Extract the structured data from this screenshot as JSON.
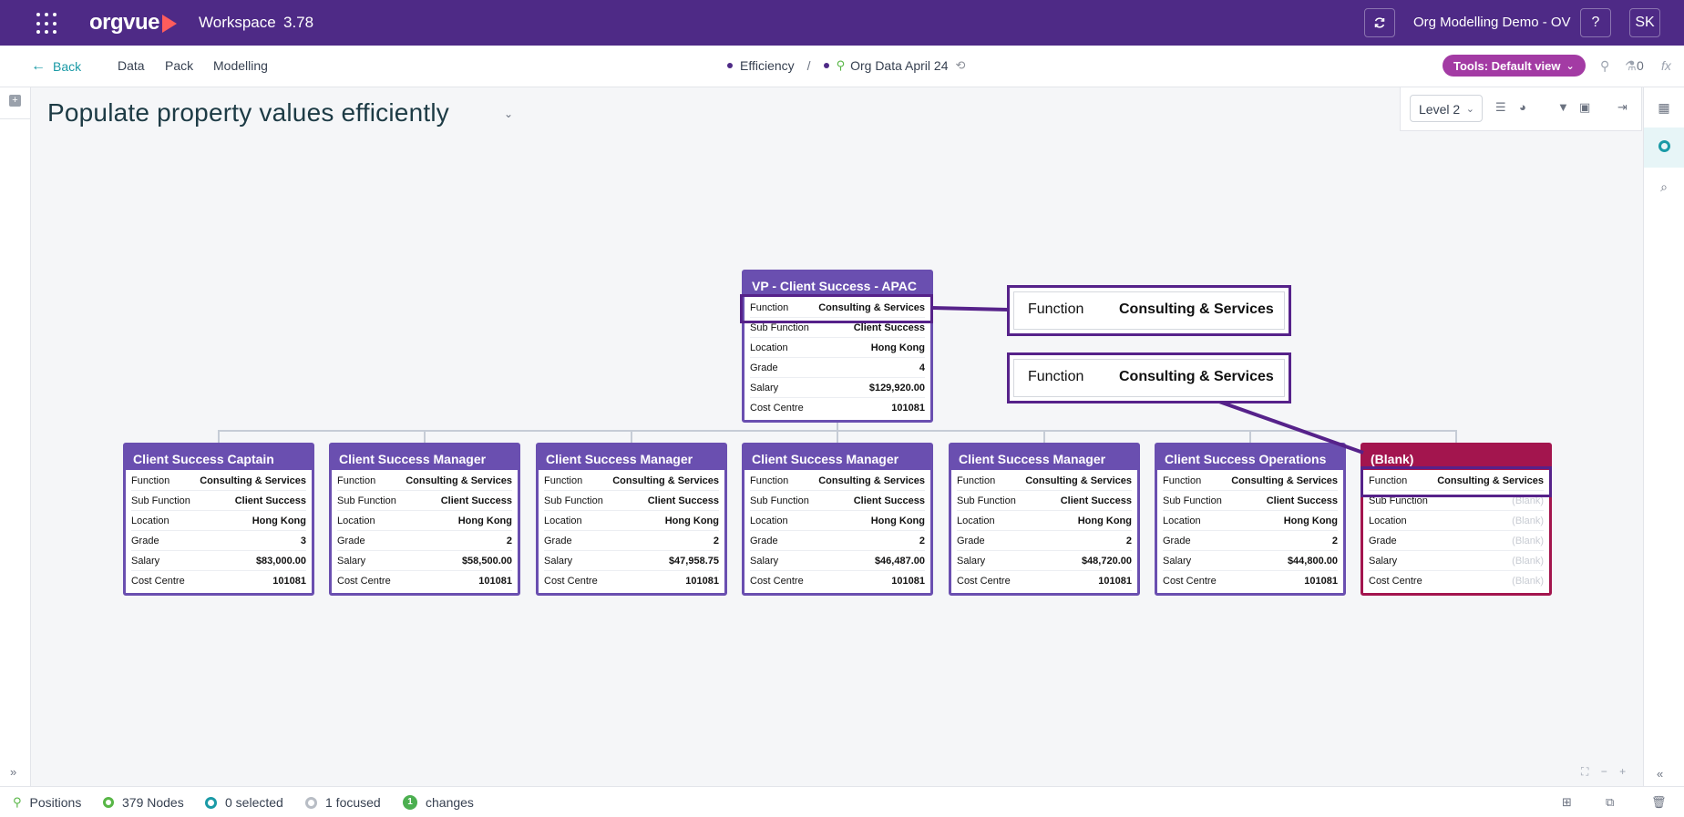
{
  "topbar": {
    "app_logo": "orgvue",
    "workspace_title": "Workspace",
    "workspace_version": "3.78",
    "project_name": "Org Modelling Demo - OV",
    "help_label": "?",
    "user_initials": "SK"
  },
  "nav": {
    "back": "Back",
    "items": [
      "Data",
      "Pack",
      "Modelling"
    ],
    "breadcrumb": {
      "view": "Efficiency",
      "separator": "/",
      "dataset": "Org Data April 24"
    },
    "tools_button": "Tools: Default view"
  },
  "status_counter": "0",
  "page": {
    "title": "Populate property values efficiently"
  },
  "view_toolbar": {
    "level": "Level 2"
  },
  "root_card": {
    "title": "VP - Client Success - APAC",
    "rows": [
      {
        "k": "Function",
        "v": "Consulting & Services"
      },
      {
        "k": "Sub Function",
        "v": "Client Success"
      },
      {
        "k": "Location",
        "v": "Hong Kong"
      },
      {
        "k": "Grade",
        "v": "4"
      },
      {
        "k": "Salary",
        "v": "$129,920.00"
      },
      {
        "k": "Cost Centre",
        "v": "101081"
      }
    ]
  },
  "child_cards": [
    {
      "title": "Client Success Captain",
      "rows": [
        {
          "k": "Function",
          "v": "Consulting & Services"
        },
        {
          "k": "Sub Function",
          "v": "Client Success"
        },
        {
          "k": "Location",
          "v": "Hong Kong"
        },
        {
          "k": "Grade",
          "v": "3"
        },
        {
          "k": "Salary",
          "v": "$83,000.00"
        },
        {
          "k": "Cost Centre",
          "v": "101081"
        }
      ]
    },
    {
      "title": "Client Success Manager",
      "rows": [
        {
          "k": "Function",
          "v": "Consulting & Services"
        },
        {
          "k": "Sub Function",
          "v": "Client Success"
        },
        {
          "k": "Location",
          "v": "Hong Kong"
        },
        {
          "k": "Grade",
          "v": "2"
        },
        {
          "k": "Salary",
          "v": "$58,500.00"
        },
        {
          "k": "Cost Centre",
          "v": "101081"
        }
      ]
    },
    {
      "title": "Client Success Manager",
      "rows": [
        {
          "k": "Function",
          "v": "Consulting & Services"
        },
        {
          "k": "Sub Function",
          "v": "Client Success"
        },
        {
          "k": "Location",
          "v": "Hong Kong"
        },
        {
          "k": "Grade",
          "v": "2"
        },
        {
          "k": "Salary",
          "v": "$47,958.75"
        },
        {
          "k": "Cost Centre",
          "v": "101081"
        }
      ]
    },
    {
      "title": "Client Success Manager",
      "rows": [
        {
          "k": "Function",
          "v": "Consulting & Services"
        },
        {
          "k": "Sub Function",
          "v": "Client Success"
        },
        {
          "k": "Location",
          "v": "Hong Kong"
        },
        {
          "k": "Grade",
          "v": "2"
        },
        {
          "k": "Salary",
          "v": "$46,487.00"
        },
        {
          "k": "Cost Centre",
          "v": "101081"
        }
      ]
    },
    {
      "title": "Client Success Manager",
      "rows": [
        {
          "k": "Function",
          "v": "Consulting & Services"
        },
        {
          "k": "Sub Function",
          "v": "Client Success"
        },
        {
          "k": "Location",
          "v": "Hong Kong"
        },
        {
          "k": "Grade",
          "v": "2"
        },
        {
          "k": "Salary",
          "v": "$48,720.00"
        },
        {
          "k": "Cost Centre",
          "v": "101081"
        }
      ]
    },
    {
      "title": "Client Success Operations",
      "rows": [
        {
          "k": "Function",
          "v": "Consulting & Services"
        },
        {
          "k": "Sub Function",
          "v": "Client Success"
        },
        {
          "k": "Location",
          "v": "Hong Kong"
        },
        {
          "k": "Grade",
          "v": "2"
        },
        {
          "k": "Salary",
          "v": "$44,800.00"
        },
        {
          "k": "Cost Centre",
          "v": "101081"
        }
      ]
    },
    {
      "title": "(Blank)",
      "rows": [
        {
          "k": "Function",
          "v": "Consulting & Services"
        },
        {
          "k": "Sub Function",
          "v": "(Blank)"
        },
        {
          "k": "Location",
          "v": "(Blank)"
        },
        {
          "k": "Grade",
          "v": "(Blank)"
        },
        {
          "k": "Salary",
          "v": "(Blank)"
        },
        {
          "k": "Cost Centre",
          "v": "(Blank)"
        }
      ]
    }
  ],
  "callouts": [
    {
      "k": "Function",
      "v": "Consulting & Services"
    },
    {
      "k": "Function",
      "v": "Consulting & Services"
    }
  ],
  "statusbar": {
    "positions": "Positions",
    "nodes": "379 Nodes",
    "selected": "0 selected",
    "focused": "1 focused",
    "changes_count": "1",
    "changes": "changes"
  },
  "colors": {
    "topbar": "#4e2a86",
    "accent": "#1a9aa6",
    "card": "#6a4fb0",
    "blank_card": "#a3154e",
    "highlight": "#56228a",
    "tools": "#a33ba4"
  }
}
